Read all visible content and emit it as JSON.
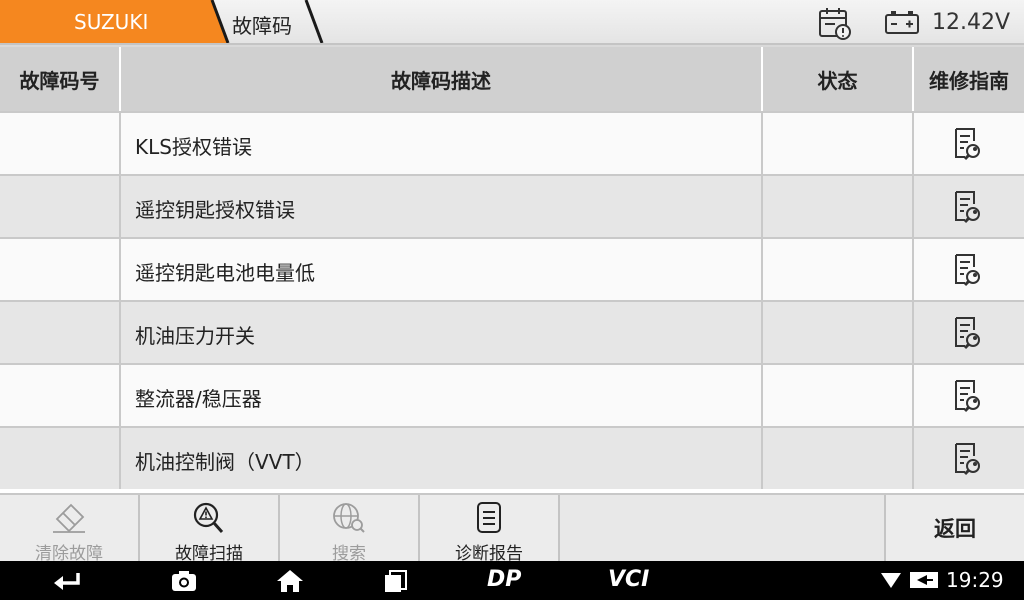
{
  "header": {
    "brand": "SUZUKI",
    "page": "故障码",
    "voltage": "12.42V"
  },
  "colors": {
    "brand_tab": "#f5871f",
    "row_alt": "#e6e6e6",
    "header_bg": "#d0d0d0"
  },
  "table": {
    "columns": [
      "故障码号",
      "故障码描述",
      "状态",
      "维修指南"
    ],
    "rows": [
      {
        "code": "",
        "desc": "KLS授权错误",
        "status": ""
      },
      {
        "code": "",
        "desc": "遥控钥匙授权错误",
        "status": ""
      },
      {
        "code": "",
        "desc": "遥控钥匙电池电量低",
        "status": ""
      },
      {
        "code": "",
        "desc": "机油压力开关",
        "status": ""
      },
      {
        "code": "",
        "desc": "整流器/稳压器",
        "status": ""
      },
      {
        "code": "",
        "desc": "机油控制阀（VVT）",
        "status": ""
      }
    ]
  },
  "toolbar": {
    "clear": "清除故障",
    "scan": "故障扫描",
    "search": "搜索",
    "report": "诊断报告",
    "back": "返回"
  },
  "statusbar": {
    "dp_label": "DP",
    "vci_label": "VCI",
    "time": "19:29"
  }
}
